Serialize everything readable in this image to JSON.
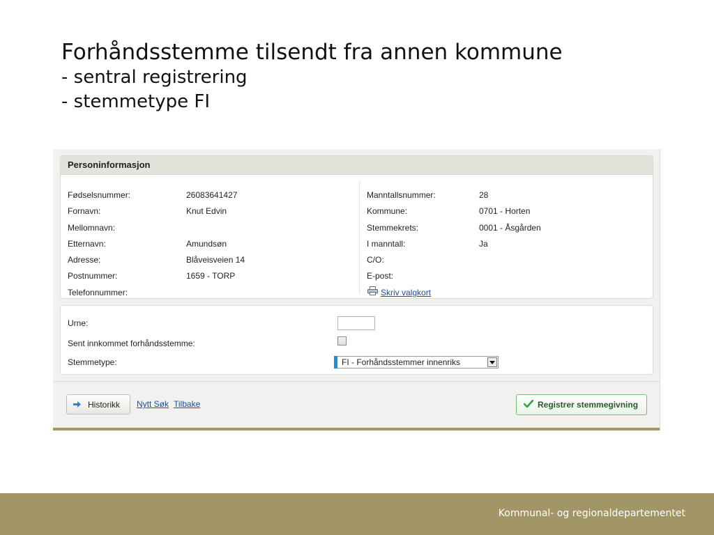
{
  "slide": {
    "title_line1": "Forhåndsstemme tilsendt fra annen kommune",
    "title_line2": "- sentral registrering",
    "title_line3": "- stemmetype FI",
    "footer": "Kommunal- og regionaldepartementet",
    "footer_color": "#a39666"
  },
  "person": {
    "header": "Personinformasjon",
    "left": [
      {
        "label": "Fødselsnummer:",
        "value": "26083641427"
      },
      {
        "label": "Fornavn:",
        "value": "Knut Edvin"
      },
      {
        "label": "Mellomnavn:",
        "value": ""
      },
      {
        "label": "Etternavn:",
        "value": "Amundsøn"
      },
      {
        "label": "Adresse:",
        "value": "Blåveisveien 14"
      },
      {
        "label": "Postnummer:",
        "value": "1659 - TORP"
      },
      {
        "label": "Telefonnummer:",
        "value": ""
      }
    ],
    "right": [
      {
        "label": "Manntallsnummer:",
        "value": "28"
      },
      {
        "label": "Kommune:",
        "value": "0701 - Horten"
      },
      {
        "label": "Stemmekrets:",
        "value": "0001 - Åsgården"
      },
      {
        "label": "I manntall:",
        "value": "Ja"
      },
      {
        "label": "C/O:",
        "value": ""
      },
      {
        "label": "E-post:",
        "value": ""
      }
    ],
    "print_link": "Skriv valgkort",
    "print_icon": "printer-icon"
  },
  "vote": {
    "urne_label": "Urne:",
    "urne_value": "",
    "late_label": "Sent innkommet forhåndsstemme:",
    "late_checked": false,
    "type_label": "Stemmetype:",
    "type_selected": "FI - Forhåndsstemmer innenriks",
    "accent_color": "#1f8fd6"
  },
  "actions": {
    "history_label": "Historikk",
    "history_icon": "arrow-right-icon",
    "new_search": "Nytt Søk",
    "back": "Tilbake",
    "register_label": "Registrer stemmegivning",
    "register_icon": "checkmark-icon"
  }
}
